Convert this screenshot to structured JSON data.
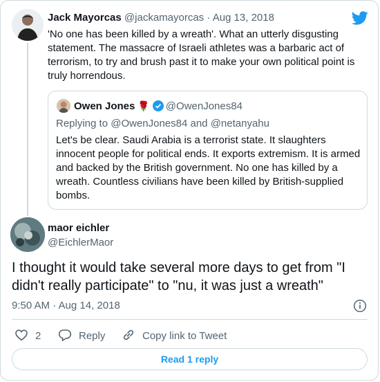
{
  "colors": {
    "accent": "#1d9bf0",
    "muted": "#536471",
    "text": "#0f1419",
    "border": "#cfd9de"
  },
  "tweet1": {
    "author_name": "Jack Mayorcas",
    "handle": "@jackamayorcas",
    "separator": "·",
    "date": "Aug 13, 2018",
    "text": "'No one has been killed by a wreath'. What an utterly disgusting statement. The massacre of Israeli athletes was a barbaric act of terrorism, to try and brush past it to make your own political point is truly horrendous."
  },
  "quoted": {
    "author_name": "Owen Jones",
    "emoji": "🌹",
    "handle": "@OwenJones84",
    "replying_to": "Replying to @OwenJones84 and @netanyahu",
    "text": "Let's be clear. Saudi Arabia is a terrorist state. It slaughters innocent people for political ends. It exports extremism. It is armed and backed by the British government. No one has killed by a wreath. Countless civilians have been killed by British-supplied bombs."
  },
  "tweet3": {
    "author_name": "maor eichler",
    "handle": "@EichlerMaor",
    "text": "I thought it would take several more days to get from \"I didn't really participate\" to \"nu, it was just a wreath\"",
    "timestamp": "9:50 AM · Aug 14, 2018"
  },
  "actions": {
    "like_count": "2",
    "reply_label": "Reply",
    "copy_label": "Copy link to Tweet"
  },
  "read_replies": "Read 1 reply",
  "icons": [
    "twitter-bird-icon",
    "verified-badge-icon",
    "info-icon",
    "heart-icon",
    "reply-bubble-icon",
    "link-icon"
  ]
}
